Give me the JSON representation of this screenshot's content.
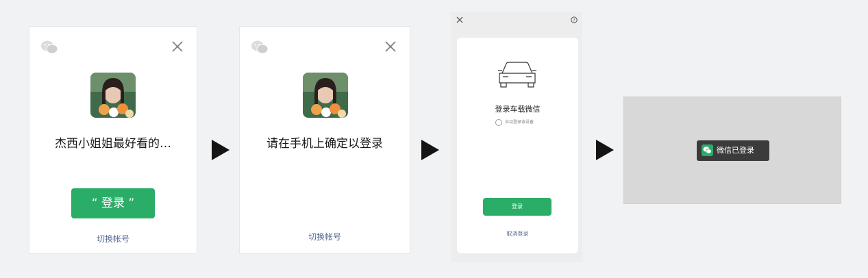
{
  "step1": {
    "nickname": "杰西小姐姐最好看的…",
    "login_button": "“ 登录 ”",
    "switch_account": "切换帐号"
  },
  "step2": {
    "message": "请在手机上确定以登录",
    "switch_account": "切换帐号"
  },
  "step3": {
    "title": "登录车载微信",
    "option_label": "自动登录该设备",
    "login_button": "登录",
    "cancel_button": "取消登录"
  },
  "step4": {
    "toast": "微信已登录"
  },
  "colors": {
    "wechat_green": "#2aae67",
    "link_blue": "#576b95",
    "page_background": "#f1f2f4"
  }
}
